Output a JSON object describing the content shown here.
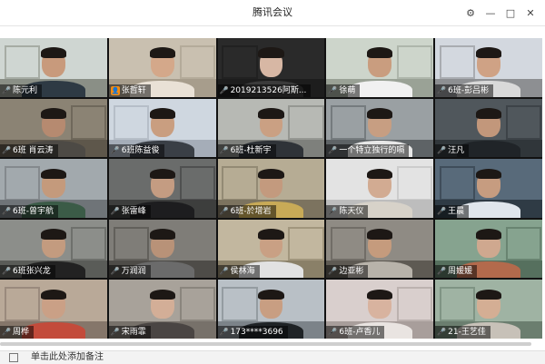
{
  "window": {
    "title": "腾讯会议",
    "buttons": {
      "settings": "⚙",
      "minimize": "—",
      "maximize": "□",
      "close": "✕"
    }
  },
  "participants": [
    {
      "name": "陈元利",
      "mic": "🎤",
      "active": true,
      "wall": "#cfd6d2",
      "floor": "#8a8f86",
      "skin": "#c89a7c",
      "shirt": "#2e3a44",
      "hair": true
    },
    {
      "name": "张哲轩",
      "mic": "",
      "host": "👤",
      "wall": "#c9c0b0",
      "floor": "#a79d8c",
      "skin": "#d4a88a",
      "shirt": "#e9e1d6",
      "hair": true
    },
    {
      "name": "2019213526阿斯...",
      "mic": "🎤",
      "wall": "#2a2a2a",
      "floor": "#1d1d1d",
      "skin": "#d7b7a4",
      "shirt": "#3b3b3b",
      "hair": true
    },
    {
      "name": "徐萌",
      "mic": "🎤",
      "wall": "#cdd5cb",
      "floor": "#9aa296",
      "skin": "#c99d7f",
      "shirt": "#f1f1f1",
      "hair": true
    },
    {
      "name": "6班-彭吕彬",
      "mic": "🎤",
      "wall": "#d3d8df",
      "floor": "#8d8f92",
      "skin": "#cfa285",
      "shirt": "#d9d9d9",
      "hair": true
    },
    {
      "name": "6班 肖云涛",
      "mic": "🎤",
      "wall": "#8b8374",
      "floor": "#5e574b",
      "skin": "#b68a70",
      "shirt": "#4d4a45",
      "hair": true
    },
    {
      "name": "6班陈益俊",
      "mic": "🎤",
      "wall": "#cfd7e0",
      "floor": "#a5adb8",
      "skin": "#c99e80",
      "shirt": "#3a3f46",
      "hair": true
    },
    {
      "name": "6班-杜新宇",
      "mic": "🎤",
      "wall": "#b7b9b4",
      "floor": "#7e807c",
      "skin": "#caa083",
      "shirt": "#2f3338",
      "hair": true
    },
    {
      "name": "一个特立独行的嗝",
      "mic": "🎤",
      "wall": "#9aa0a3",
      "floor": "#5e6366",
      "skin": "#c79e82",
      "shirt": "#e7e7e7",
      "hair": true
    },
    {
      "name": "汪凡",
      "mic": "🎤",
      "wall": "#50575c",
      "floor": "#30363a",
      "skin": "#c2977b",
      "shirt": "#202428",
      "hair": true
    },
    {
      "name": "6班-曾宇航",
      "mic": "🎤",
      "wall": "#a2a9ad",
      "floor": "#6f7478",
      "skin": "#c49a7c",
      "shirt": "#3b5b47",
      "hair": true
    },
    {
      "name": "张雷峰",
      "mic": "🎤",
      "wall": "#6a6c6b",
      "floor": "#3d3e3d",
      "skin": "#c49c82",
      "shirt": "#1d1d1f",
      "hair": true
    },
    {
      "name": "6班-於增岩",
      "mic": "🎤",
      "wall": "#b6ac94",
      "floor": "#7c735f",
      "skin": "#c39a7e",
      "shirt": "#c8aa57",
      "hair": true
    },
    {
      "name": "陈天仪",
      "mic": "🎤",
      "wall": "#e3e3e3",
      "floor": "#bdbdbd",
      "skin": "#d2ab92",
      "shirt": "#d7d2c9",
      "hair": true
    },
    {
      "name": "王晨",
      "mic": "🎤",
      "wall": "#586a7a",
      "floor": "#2f3b45",
      "skin": "#c69c80",
      "shirt": "#e0e6ec",
      "hair": true
    },
    {
      "name": "6班张兴龙",
      "mic": "🎤",
      "wall": "#8c8e8a",
      "floor": "#5a5c58",
      "skin": "#c39b7f",
      "shirt": "#222222",
      "hair": true
    },
    {
      "name": "万润润",
      "mic": "🎤",
      "wall": "#7f7d78",
      "floor": "#4e4c48",
      "skin": "#b89278",
      "shirt": "#6b6b6b",
      "hair": true
    },
    {
      "name": "侯林海",
      "mic": "🎤",
      "wall": "#c2b79f",
      "floor": "#8a8068",
      "skin": "#c9a084",
      "shirt": "#e2e2e2",
      "hair": true
    },
    {
      "name": "边亚彬",
      "mic": "🎤",
      "wall": "#8f8b84",
      "floor": "#5e5a53",
      "skin": "#c59b7d",
      "shirt": "#b8b3aa",
      "hair": true
    },
    {
      "name": "周媛媛",
      "mic": "🎤",
      "wall": "#86a38f",
      "floor": "#56705e",
      "skin": "#cfa88f",
      "shirt": "#b36a4c",
      "hair": true
    },
    {
      "name": "周桦",
      "mic": "🎤",
      "wall": "#b9a998",
      "floor": "#85766a",
      "skin": "#caa086",
      "shirt": "#c34b3b",
      "hair": true
    },
    {
      "name": "宋雨霏",
      "mic": "🎤",
      "wall": "#a8a29a",
      "floor": "#77716a",
      "skin": "#d3ae97",
      "shirt": "#4a4543",
      "hair": true
    },
    {
      "name": "173****3696",
      "mic": "🎤",
      "wall": "#b9c0c6",
      "floor": "#7c8389",
      "skin": "#c89e82",
      "shirt": "#1f2326",
      "hair": true
    },
    {
      "name": "6班-卢香儿",
      "mic": "🎤",
      "wall": "#d9cfcd",
      "floor": "#a89e9b",
      "skin": "#d8b39f",
      "shirt": "#e9e4e1",
      "hair": true
    },
    {
      "name": "21-王艺佳",
      "mic": "🎤",
      "wall": "#9fb3a3",
      "floor": "#6b7e6f",
      "skin": "#d4ae94",
      "shirt": "#c7c1b8",
      "hair": true
    }
  ],
  "footer": {
    "note_label": "单击此处添加备注"
  }
}
